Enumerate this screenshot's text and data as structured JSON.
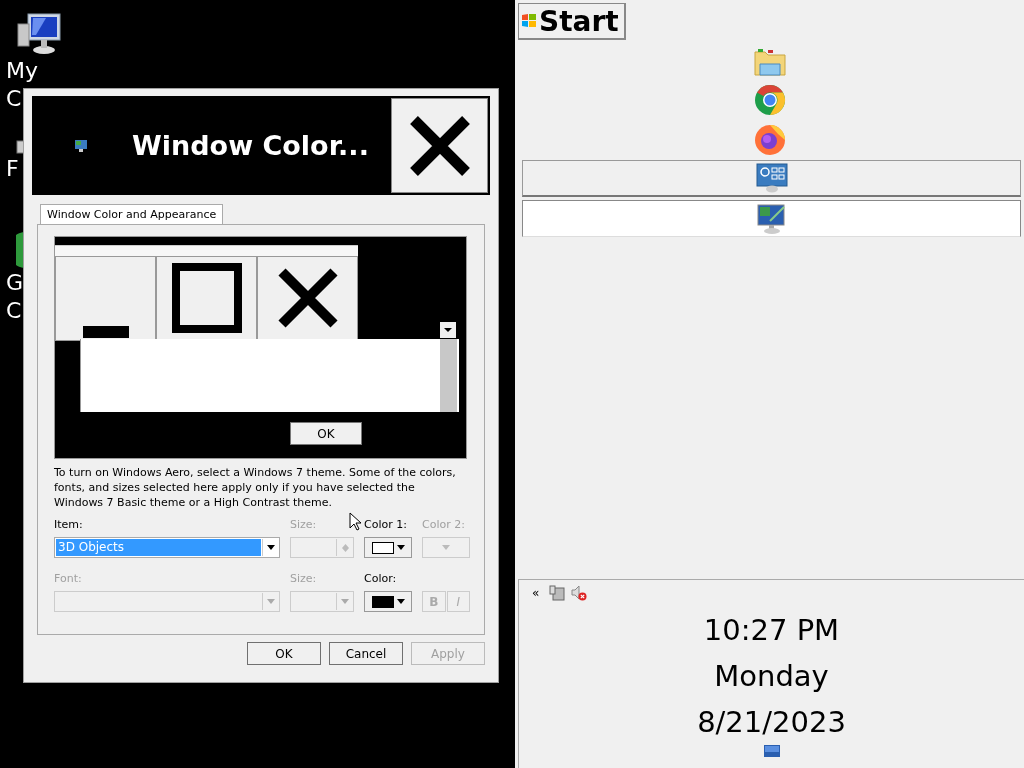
{
  "desktop": {
    "icons": [
      {
        "kind": "computer",
        "label_lines": [
          "My",
          "C"
        ]
      },
      {
        "kind": "file",
        "label_lines": [
          "F"
        ]
      },
      {
        "kind": "app",
        "label_lines": [
          "G",
          "C"
        ]
      }
    ]
  },
  "dialog": {
    "title": "Window Color...",
    "tabs": [
      {
        "label": "Window Color and Appearance",
        "selected": true
      }
    ],
    "preview": {
      "button": "OK"
    },
    "description": "To turn on Windows Aero, select a Windows 7 theme.  Some of the colors, fonts, and sizes selected here apply only if you have selected the Windows 7 Basic theme or a High Contrast theme.",
    "fields": [
      {
        "kind": "combo",
        "label": "Item:",
        "value": "3D Objects",
        "disabled": false
      },
      {
        "kind": "spinner",
        "label": "Size:",
        "disabled": true
      },
      {
        "kind": "color",
        "label": "Color 1:",
        "color": "#ffffff",
        "disabled": false
      },
      {
        "kind": "color",
        "label": "Color 2:",
        "disabled": true
      },
      {
        "kind": "combo",
        "label": "Font:",
        "disabled": true
      },
      {
        "kind": "combo",
        "label": "Size:",
        "disabled": true
      },
      {
        "kind": "color",
        "label": "Color:",
        "color": "#000000",
        "disabled": false
      },
      {
        "kind": "style",
        "buttons": [
          {
            "label": "B",
            "disabled": true
          },
          {
            "label": "I",
            "disabled": true
          }
        ]
      }
    ],
    "buttons": [
      {
        "label": "OK",
        "disabled": false
      },
      {
        "label": "Cancel",
        "disabled": false
      },
      {
        "label": "Apply",
        "disabled": true
      }
    ]
  },
  "taskbar": {
    "start": "Start",
    "launchers": [
      {
        "kind": "folder"
      },
      {
        "kind": "chrome"
      },
      {
        "kind": "firefox"
      }
    ],
    "tasks": [
      {
        "kind": "control-panel",
        "selected": false
      },
      {
        "kind": "display",
        "selected": true
      }
    ],
    "tray": {
      "expand": "«",
      "time": "10:27 PM",
      "day": "Monday",
      "date": "8/21/2023"
    }
  }
}
